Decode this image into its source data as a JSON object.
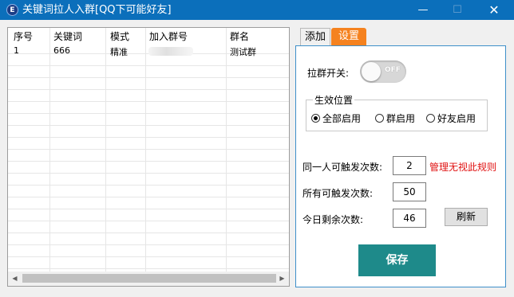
{
  "window": {
    "title": "关键词拉人入群[QQ下可能好友]",
    "icon_glyph": "E",
    "buttons": {
      "minimize": "—",
      "maximize": "☐",
      "close": "✕"
    }
  },
  "table": {
    "headers": [
      "序号",
      "关键词",
      "模式",
      "加入群号",
      "群名"
    ],
    "rows": [
      {
        "index": "1",
        "keyword": "666",
        "mode": "精准",
        "group_number": "",
        "group_name": "测试群"
      }
    ]
  },
  "tabs": [
    {
      "label": "添加",
      "active": false
    },
    {
      "label": "设置",
      "active": true
    }
  ],
  "settings": {
    "switch_label": "拉群开关:",
    "switch_state": "OFF",
    "scope_title": "生效位置",
    "scope_options": [
      {
        "label": "全部启用",
        "checked": true
      },
      {
        "label": "群启用",
        "checked": false
      },
      {
        "label": "好友启用",
        "checked": false
      }
    ],
    "per_user_label": "同一人可触发次数:",
    "per_user_value": "2",
    "admin_hint": "管理无视此规则",
    "total_label": "所有可触发次数:",
    "total_value": "50",
    "remaining_label": "今日剩余次数:",
    "remaining_value": "46",
    "refresh_label": "刷新",
    "save_label": "保存"
  },
  "colors": {
    "titlebar": "#0b6fbb",
    "active_tab": "#f5821f",
    "save_button": "#1e8a8a",
    "hint_text": "#e01010"
  }
}
